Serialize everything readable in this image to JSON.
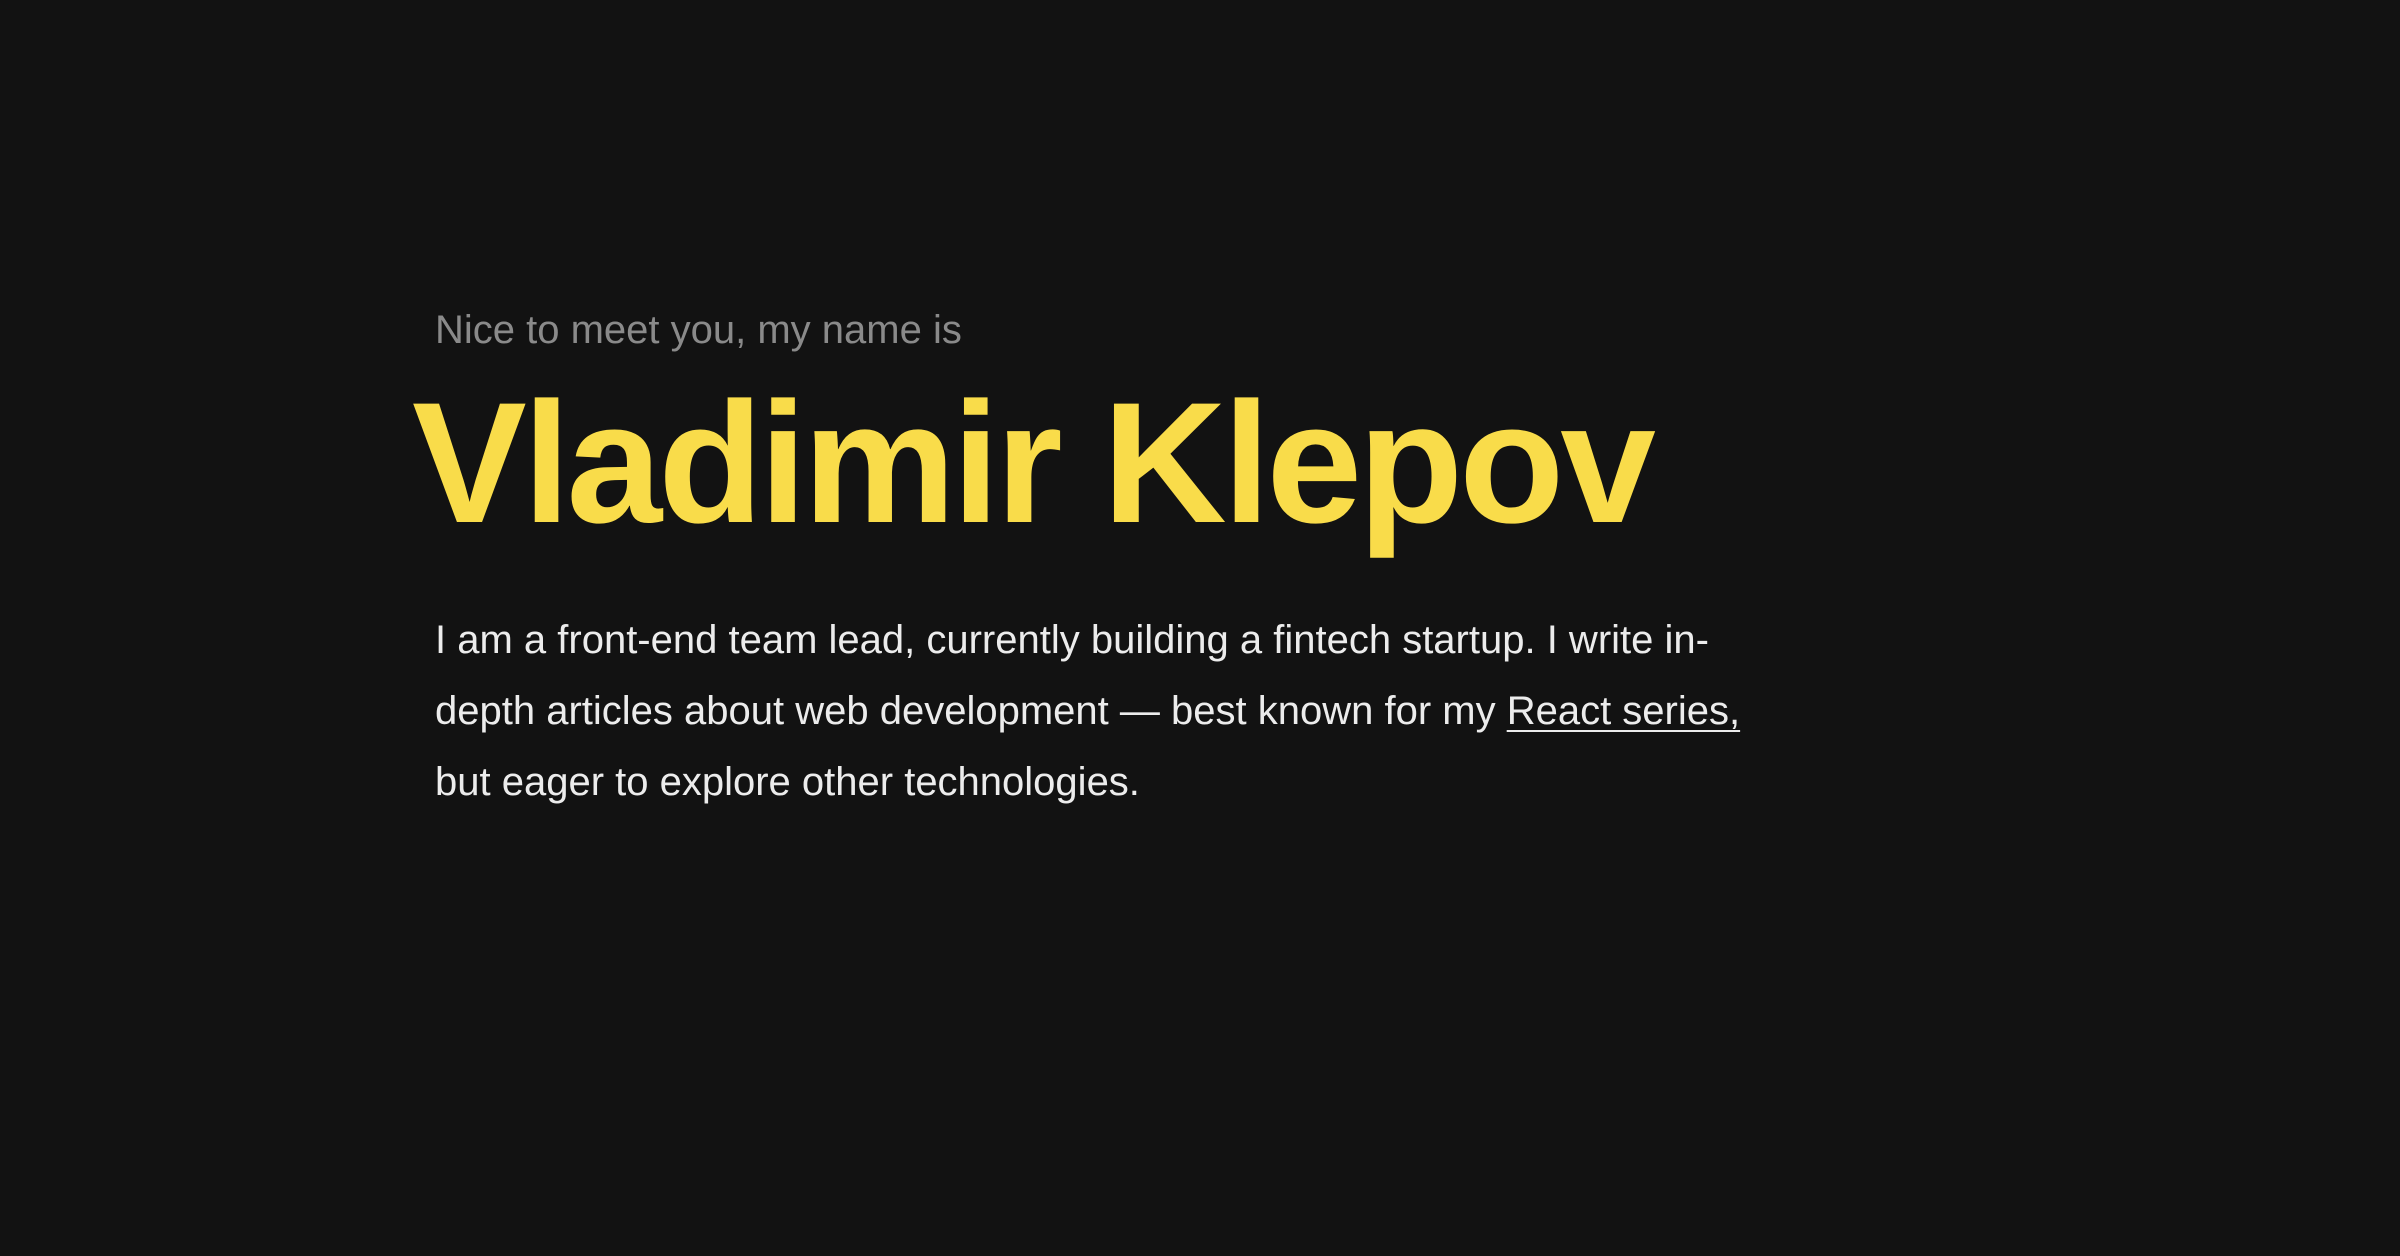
{
  "hero": {
    "intro": "Nice to meet you, my name is",
    "name": "Vladimir Klepov",
    "bio": {
      "line1": "I am a front-end team lead, currently building a fintech startup. I write in-",
      "line2": "depth articles about web development — best known for my ",
      "link_label": "React series,",
      "line3": "but eager to explore other technologies."
    }
  },
  "colors": {
    "background": "#121212",
    "accent": "#f9dc4a",
    "muted_text": "#8a8a8a",
    "body_text": "#ececec"
  }
}
